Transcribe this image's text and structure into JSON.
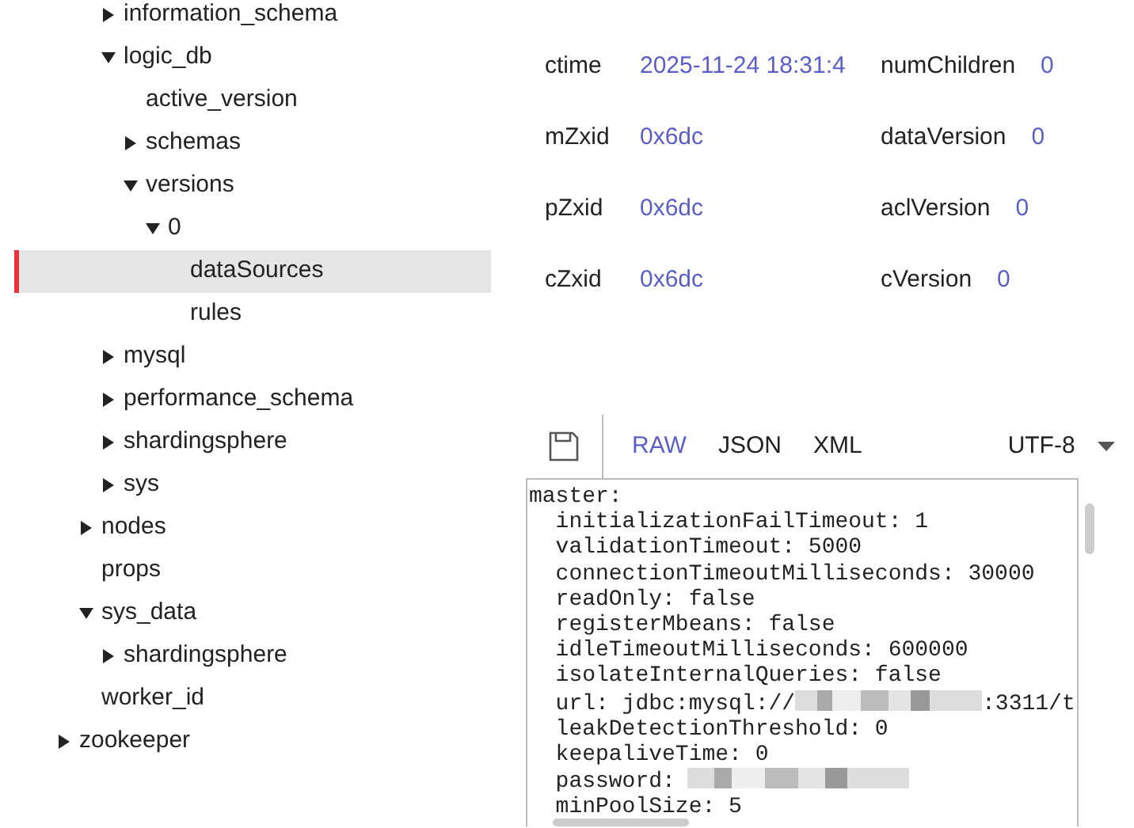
{
  "tree": [
    {
      "children": [
        {
          "children": [
            {
              "label": "information_schema",
              "expanded": false,
              "selected": false
            },
            {
              "label": "logic_db",
              "expanded": true,
              "selected": false,
              "children": [
                {
                  "label": "active_version",
                  "selected": false
                },
                {
                  "label": "schemas",
                  "expanded": false,
                  "selected": false
                },
                {
                  "label": "versions",
                  "expanded": true,
                  "selected": false,
                  "children": [
                    {
                      "label": "0",
                      "expanded": true,
                      "selected": false,
                      "children": [
                        {
                          "label": "dataSources",
                          "selected": true
                        },
                        {
                          "label": "rules",
                          "selected": false
                        }
                      ]
                    }
                  ]
                }
              ]
            },
            {
              "label": "mysql",
              "expanded": false,
              "selected": false
            },
            {
              "label": "performance_schema",
              "expanded": false,
              "selected": false
            },
            {
              "label": "shardingsphere",
              "expanded": false,
              "selected": false
            },
            {
              "label": "sys",
              "expanded": false,
              "selected": false
            }
          ]
        },
        {
          "label": "nodes",
          "expanded": false,
          "selected": false
        },
        {
          "label": "props",
          "selected": false
        },
        {
          "label": "sys_data",
          "expanded": true,
          "selected": false,
          "children": [
            {
              "label": "shardingsphere",
              "expanded": false,
              "selected": false
            }
          ]
        },
        {
          "label": "worker_id",
          "selected": false
        }
      ]
    },
    {
      "label": "zookeeper",
      "expanded": false,
      "selected": false
    }
  ],
  "stats": [
    {
      "label": "ctime",
      "value": "2025-11-24 18:31:4"
    },
    {
      "label": "numChildren",
      "value": "0"
    },
    {
      "label": "mZxid",
      "value": "0x6dc"
    },
    {
      "label": "dataVersion",
      "value": "0"
    },
    {
      "label": "pZxid",
      "value": "0x6dc"
    },
    {
      "label": "aclVersion",
      "value": "0"
    },
    {
      "label": "cZxid",
      "value": "0x6dc"
    },
    {
      "label": "cVersion",
      "value": "0"
    }
  ],
  "toolbar": {
    "formats": [
      {
        "label": "RAW",
        "selected": true
      },
      {
        "label": "JSON",
        "selected": false
      },
      {
        "label": "XML",
        "selected": false
      }
    ],
    "encoding": "UTF-8"
  },
  "editor": {
    "lines": [
      {
        "text": "master:"
      },
      {
        "text": "  initializationFailTimeout: 1"
      },
      {
        "text": "  validationTimeout: 5000"
      },
      {
        "text": "  connectionTimeoutMilliseconds: 30000"
      },
      {
        "text": "  readOnly: false"
      },
      {
        "text": "  registerMbeans: false"
      },
      {
        "text": "  idleTimeoutMilliseconds: 600000"
      },
      {
        "text": "  isolateInternalQueries: false"
      },
      {
        "text": "  url: jdbc:mysql://",
        "redacted": true,
        "after": ":3311/t"
      },
      {
        "text": "  leakDetectionThreshold: 0"
      },
      {
        "text": "  keepaliveTime: 0"
      },
      {
        "text": "  password:",
        "redacted": true
      },
      {
        "text": "  minPoolSize: 5"
      }
    ]
  }
}
